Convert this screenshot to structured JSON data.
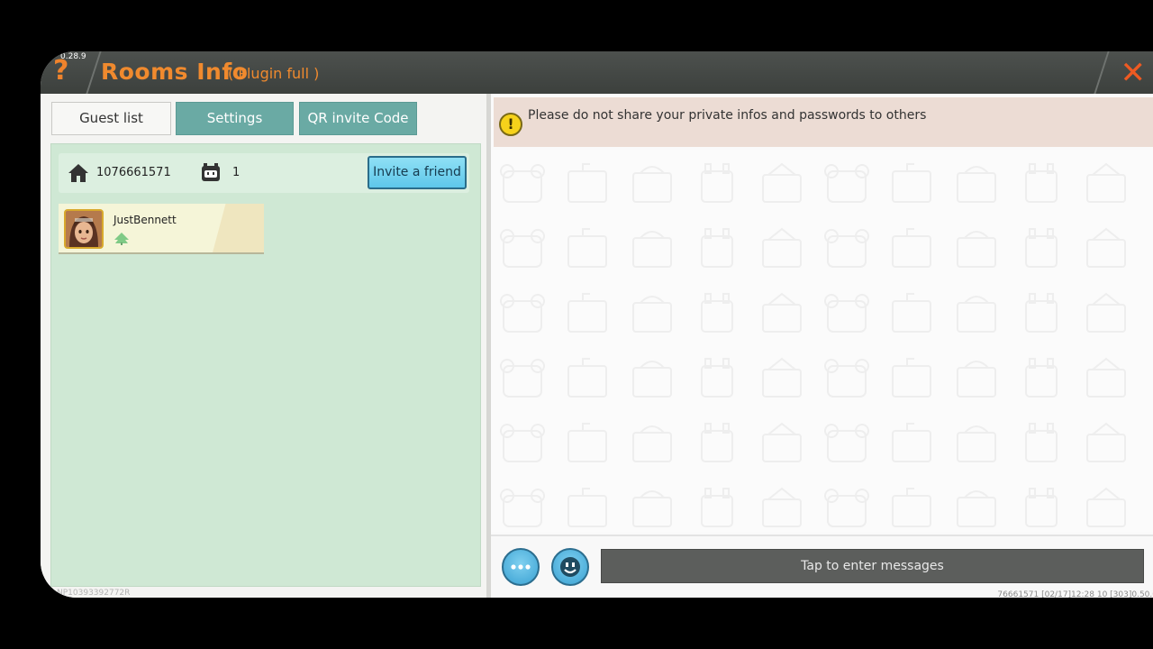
{
  "header": {
    "version": "0.28.9",
    "title": "Rooms Info",
    "subtitle": "( Plugin full )"
  },
  "tabs": [
    {
      "label": "Guest list",
      "active": true
    },
    {
      "label": "Settings",
      "active": false
    },
    {
      "label": "QR invite Code",
      "active": false
    }
  ],
  "room": {
    "id": "1076661571",
    "player_count": "1",
    "invite_label": "Invite a friend"
  },
  "players": [
    {
      "name": "JustBennett"
    }
  ],
  "footer_left": "NP10393392772R",
  "chat": {
    "warning": "Please do not share your private infos and passwords to others",
    "input_placeholder": "Tap to enter messages",
    "status_line": "76661571  [02/17]12:28 10  [303]0.50.0"
  },
  "colors": {
    "accent_orange": "#f08a2e",
    "tab_teal": "#6aaaa4",
    "panel_green": "#cfe8d4",
    "button_blue": "#5ec7ea"
  }
}
